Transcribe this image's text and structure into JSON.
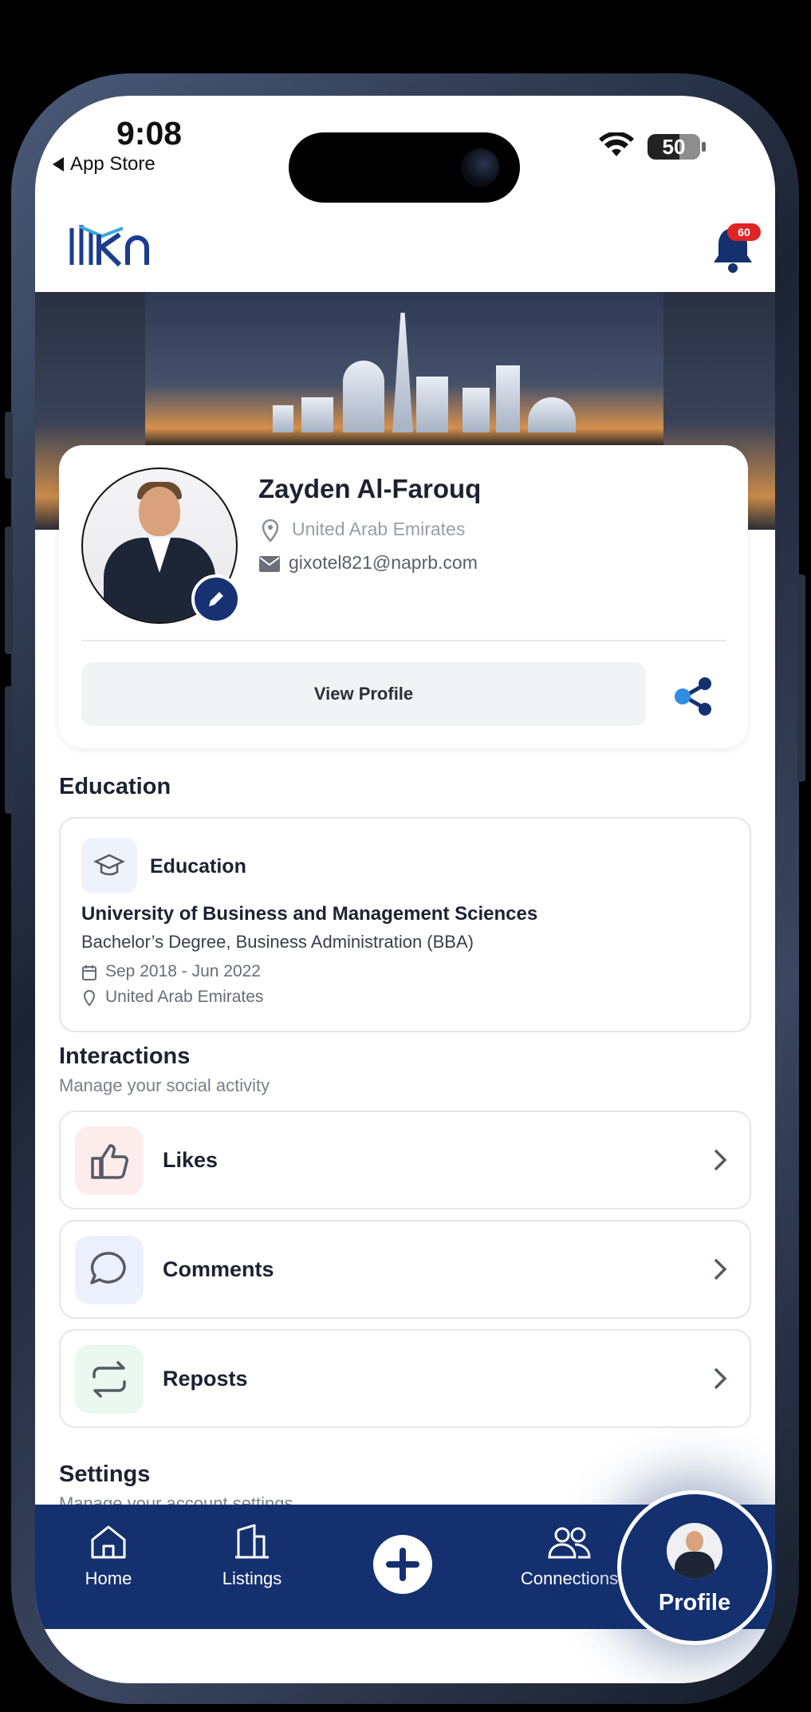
{
  "status_bar": {
    "time": "9:08",
    "back_app": "App Store",
    "battery": "50"
  },
  "header": {
    "logo_text": "Rn",
    "notification_count": "60"
  },
  "profile": {
    "name": "Zayden Al-Farouq",
    "location": "United Arab Emirates",
    "email": "gixotel821@naprb.com",
    "view_profile_label": "View Profile"
  },
  "education": {
    "section_title": "Education",
    "card_label": "Education",
    "university": "University of Business and Management Sciences",
    "degree": "Bachelor’s Degree, Business Administration (BBA)",
    "dates": "Sep 2018 - Jun 2022",
    "location": "United Arab Emirates"
  },
  "interactions": {
    "title": "Interactions",
    "subtitle": "Manage your social activity",
    "items": [
      {
        "label": "Likes",
        "icon": "thumbs-up-icon",
        "bg": "#fdecec"
      },
      {
        "label": "Comments",
        "icon": "comment-icon",
        "bg": "#eaf1fc"
      },
      {
        "label": "Reposts",
        "icon": "repost-icon",
        "bg": "#eaf8ef"
      }
    ]
  },
  "settings": {
    "title": "Settings",
    "subtitle": "Manage your account settings"
  },
  "nav": {
    "home": "Home",
    "listings": "Listings",
    "connections": "Connections",
    "profile": "Profile"
  },
  "colors": {
    "brand": "#14306f",
    "badge": "#e02424"
  }
}
